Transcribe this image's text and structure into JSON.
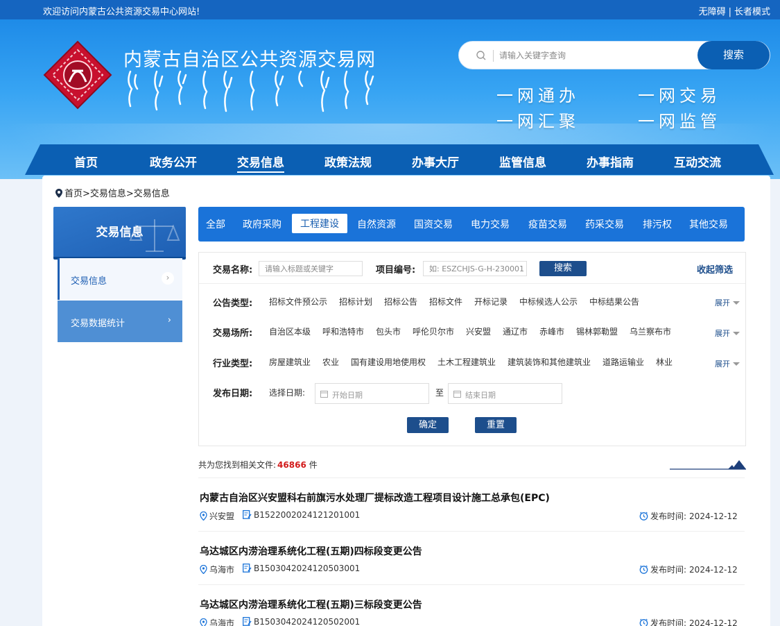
{
  "topbar": {
    "welcome": "欢迎访问内蒙古公共资源交易中心网站!",
    "accessibility": "无障碍",
    "elder_mode": "长者模式"
  },
  "header": {
    "site_title": "内蒙古自治区公共资源交易网",
    "search_placeholder": "请输入关键字查询",
    "search_button": "搜索",
    "slogans": [
      "一网通办",
      "一网交易",
      "一网汇聚",
      "一网监管"
    ]
  },
  "nav": {
    "items": [
      "首页",
      "政务公开",
      "交易信息",
      "政策法规",
      "办事大厅",
      "监管信息",
      "办事指南",
      "互动交流"
    ],
    "active": "交易信息"
  },
  "breadcrumb": "首页>交易信息>交易信息",
  "sidebar": {
    "header": "交易信息",
    "items": [
      "交易信息",
      "交易数据统计"
    ]
  },
  "categories": {
    "items": [
      "全部",
      "政府采购",
      "工程建设",
      "自然资源",
      "国资交易",
      "电力交易",
      "疫苗交易",
      "药采交易",
      "排污权",
      "其他交易"
    ],
    "active": "工程建设"
  },
  "filter": {
    "name_label": "交易名称:",
    "name_placeholder": "请输入标题或关键字",
    "code_label": "项目编号:",
    "code_placeholder": "如: ESZCHJS-G-H-230001",
    "search_button": "搜索",
    "collapse": "收起筛选",
    "notice_type": {
      "label": "公告类型:",
      "options": [
        "招标文件预公示",
        "招标计划",
        "招标公告",
        "招标文件",
        "开标记录",
        "中标候选人公示",
        "中标结果公告"
      ],
      "expand": "展开"
    },
    "location": {
      "label": "交易场所:",
      "options": [
        "自治区本级",
        "呼和浩特市",
        "包头市",
        "呼伦贝尔市",
        "兴安盟",
        "通辽市",
        "赤峰市",
        "锡林郭勒盟",
        "乌兰察布市"
      ],
      "expand": "展开"
    },
    "industry": {
      "label": "行业类型:",
      "options": [
        "房屋建筑业",
        "农业",
        "国有建设用地使用权",
        "土木工程建筑业",
        "建筑装饰和其他建筑业",
        "道路运输业",
        "林业"
      ],
      "expand": "展开"
    },
    "date": {
      "label": "发布日期:",
      "select_label": "选择日期:",
      "start_placeholder": "开始日期",
      "to": "至",
      "end_placeholder": "结束日期"
    },
    "confirm": "确定",
    "reset": "重置"
  },
  "results": {
    "prefix": "共为您找到相关文件:",
    "count": "46866",
    "unit": "件",
    "items": [
      {
        "title": "内蒙古自治区兴安盟科右前旗污水处理厂提标改造工程项目设计施工总承包(EPC)",
        "location": "兴安盟",
        "code": "B1522002024121201001",
        "date_label": "发布时间:",
        "date": "2024-12-12"
      },
      {
        "title": "乌达城区内涝治理系统化工程(五期)四标段变更公告",
        "location": "乌海市",
        "code": "B1503042024120503001",
        "date_label": "发布时间:",
        "date": "2024-12-12"
      },
      {
        "title": "乌达城区内涝治理系统化工程(五期)三标段变更公告",
        "location": "乌海市",
        "code": "B1503042024120502001",
        "date_label": "发布时间:",
        "date": "2024-12-12"
      }
    ]
  },
  "colors": {
    "primary": "#1a73d9",
    "nav": "#0b5fb3",
    "dark_button": "#1d4e8c",
    "count": "#d21a1a"
  }
}
